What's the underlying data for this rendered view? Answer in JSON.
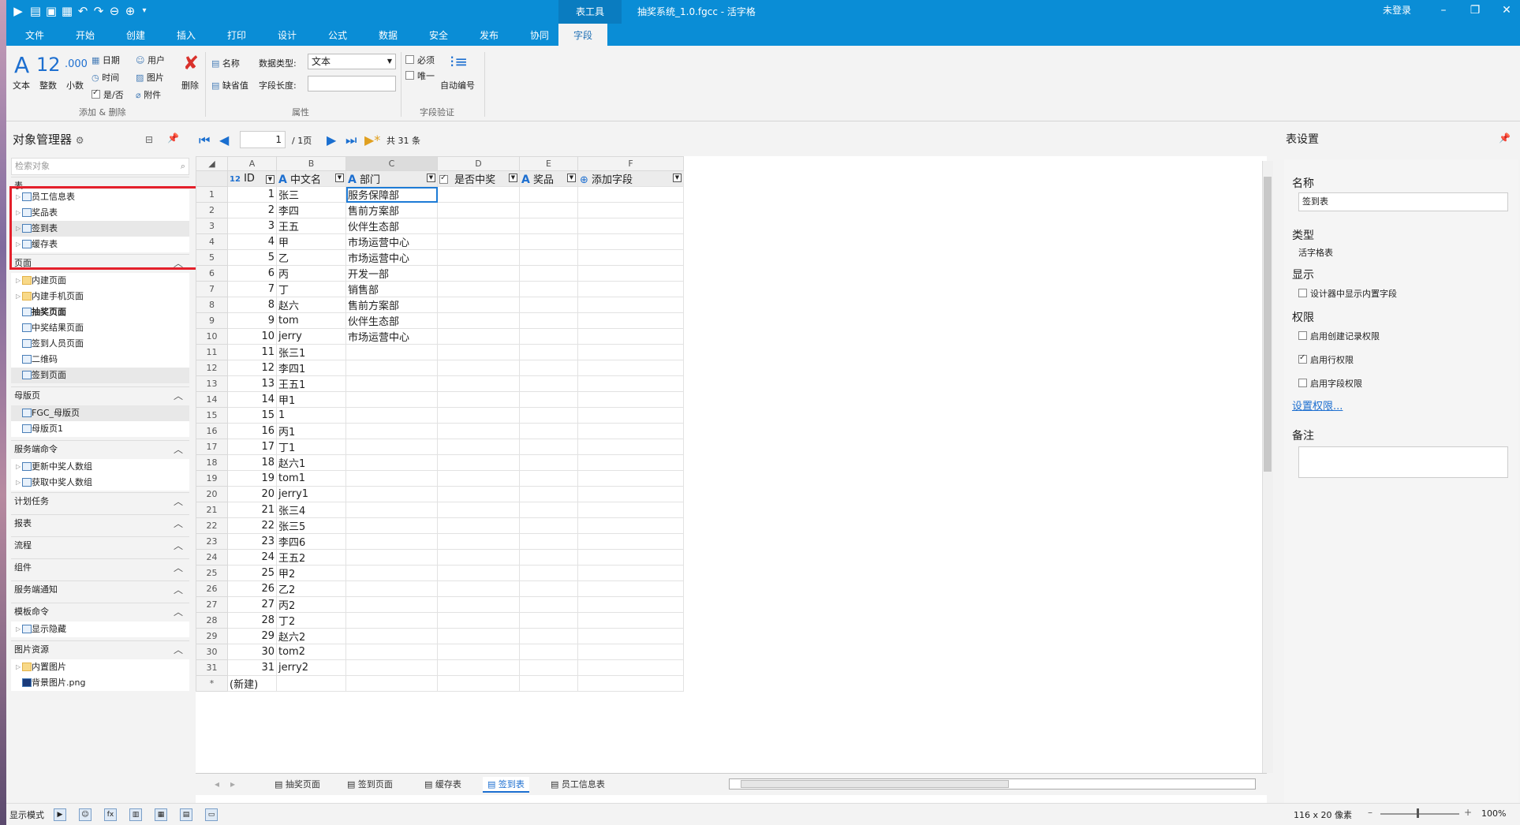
{
  "window": {
    "title": "抽奖系统_1.0.fgcc - 活字格",
    "context_tab": "表工具",
    "login": "未登录"
  },
  "menu": {
    "tabs": [
      "文件",
      "开始",
      "创建",
      "插入",
      "打印",
      "设计",
      "公式",
      "数据",
      "安全",
      "发布",
      "协同",
      "字段"
    ],
    "active": "字段"
  },
  "ribbon": {
    "text": "文本",
    "integer": "整数",
    "decimal": "小数",
    "integer_glyph": "12",
    "decimal_glyph": ".000",
    "date": "日期",
    "time": "时间",
    "yesno": "是/否",
    "user": "用户",
    "image": "图片",
    "attachment": "附件",
    "delete": "删除",
    "group_add": "添加 & 删除",
    "name": "名称",
    "data_type_label": "数据类型:",
    "data_type_value": "文本",
    "default": "缺省值",
    "field_length": "字段长度:",
    "group_props": "属性",
    "required": "必须",
    "unique": "唯一",
    "auto_number": "自动编号",
    "group_validate": "字段验证"
  },
  "left_panel": {
    "title": "对象管理器",
    "search_placeholder": "检索对象",
    "sections": {
      "tables": {
        "label": "表",
        "items": [
          "员工信息表",
          "奖品表",
          "签到表",
          "缓存表"
        ]
      },
      "pages": {
        "label": "页面",
        "items": [
          "内建页面",
          "内建手机页面",
          "抽奖页面",
          "中奖结果页面",
          "签到人员页面",
          "二维码",
          "签到页面"
        ]
      },
      "masters": {
        "label": "母版页",
        "items": [
          "FGC_母版页",
          "母版页1"
        ]
      },
      "server_cmds": {
        "label": "服务端命令",
        "items": [
          "更新中奖人数组",
          "获取中奖人数组"
        ]
      },
      "scheduled": {
        "label": "计划任务"
      },
      "reports": {
        "label": "报表"
      },
      "flows": {
        "label": "流程"
      },
      "components": {
        "label": "组件"
      },
      "server_notify": {
        "label": "服务端通知"
      },
      "template_cmds": {
        "label": "模板命令",
        "items": [
          "显示隐藏"
        ]
      },
      "images": {
        "label": "图片资源",
        "items": [
          "内置图片",
          "背景图片.png"
        ]
      }
    }
  },
  "pager": {
    "page": "1",
    "pages": "/ 1页",
    "total": "共 31 条"
  },
  "grid": {
    "columns": [
      "A",
      "B",
      "C",
      "D",
      "E",
      "F"
    ],
    "fields": [
      "ID",
      "中文名",
      "部门",
      "是否中奖",
      "奖品",
      "添加字段"
    ],
    "rows": [
      [
        "1",
        "张三",
        "服务保障部"
      ],
      [
        "2",
        "李四",
        "售前方案部"
      ],
      [
        "3",
        "王五",
        "伙伴生态部"
      ],
      [
        "4",
        "甲",
        "市场运营中心"
      ],
      [
        "5",
        "乙",
        "市场运营中心"
      ],
      [
        "6",
        "丙",
        "开发一部"
      ],
      [
        "7",
        "丁",
        "销售部"
      ],
      [
        "8",
        "赵六",
        "售前方案部"
      ],
      [
        "9",
        "tom",
        "伙伴生态部"
      ],
      [
        "10",
        "jerry",
        "市场运营中心"
      ],
      [
        "11",
        "张三1",
        ""
      ],
      [
        "12",
        "李四1",
        ""
      ],
      [
        "13",
        "王五1",
        ""
      ],
      [
        "14",
        "甲1",
        ""
      ],
      [
        "15",
        "1",
        ""
      ],
      [
        "16",
        "丙1",
        ""
      ],
      [
        "17",
        "丁1",
        ""
      ],
      [
        "18",
        "赵六1",
        ""
      ],
      [
        "19",
        "tom1",
        ""
      ],
      [
        "20",
        "jerry1",
        ""
      ],
      [
        "21",
        "张三4",
        ""
      ],
      [
        "22",
        "张三5",
        ""
      ],
      [
        "23",
        "李四6",
        ""
      ],
      [
        "24",
        "王五2",
        ""
      ],
      [
        "25",
        "甲2",
        ""
      ],
      [
        "26",
        "乙2",
        ""
      ],
      [
        "27",
        "丙2",
        ""
      ],
      [
        "28",
        "丁2",
        ""
      ],
      [
        "29",
        "赵六2",
        ""
      ],
      [
        "30",
        "tom2",
        ""
      ],
      [
        "31",
        "jerry2",
        ""
      ]
    ],
    "new_row_marker": "*",
    "new_row_label": "(新建)"
  },
  "sheet_tabs": [
    "抽奖页面",
    "签到页面",
    "缓存表",
    "签到表",
    "员工信息表"
  ],
  "sheet_tabs_active": "签到表",
  "right_panel": {
    "title": "表设置",
    "name_label": "名称",
    "name_value": "签到表",
    "type_label": "类型",
    "type_value": "活字格表",
    "display_label": "显示",
    "show_builtin": "设计器中显示内置字段",
    "perm_label": "权限",
    "perm_create": "启用创建记录权限",
    "perm_row": "启用行权限",
    "perm_field": "启用字段权限",
    "perm_link": "设置权限...",
    "note_label": "备注"
  },
  "status": {
    "mode": "显示模式",
    "size": "116 x 20 像素",
    "zoom": "100%"
  }
}
